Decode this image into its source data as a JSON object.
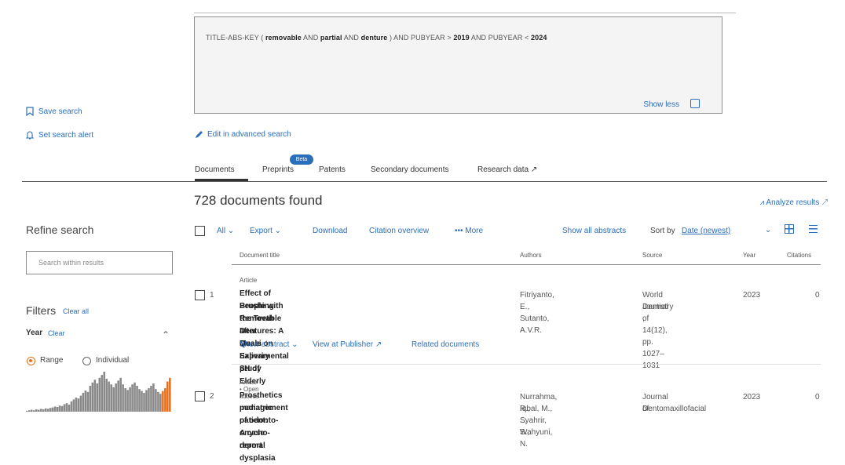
{
  "query": {
    "prefix": "TITLE-ABS-KEY ( ",
    "t1": "removable",
    "op1": " AND ",
    "t2": "partial",
    "op2": " AND ",
    "t3": "denture",
    "mid": " ) AND PUBYEAR > ",
    "y1": "2019",
    "mid2": " AND PUBYEAR < ",
    "y2": "2024",
    "show_less": "Show less"
  },
  "sidebar": {
    "save_search": "Save search",
    "set_alert": "Set search alert",
    "refine_title": "Refine search",
    "search_within_placeholder": "Search within results",
    "filters_title": "Filters",
    "clear_all": "Clear all",
    "year_label": "Year",
    "year_clear": "Clear",
    "range_label": "Range",
    "individual_label": "Individual"
  },
  "edit_advanced": "Edit in advanced search",
  "tabs": {
    "documents": "Documents",
    "preprints": "Preprints",
    "beta": "Beta",
    "patents": "Patents",
    "secondary": "Secondary documents",
    "research_data": "Research data ↗"
  },
  "results": {
    "count_text": "728 documents found",
    "analyze": "Analyze results ↗"
  },
  "toolbar": {
    "all": "All ⌄",
    "export": "Export ⌄",
    "download": "Download",
    "citation_overview": "Citation overview",
    "more": "••• More",
    "show_all_abstracts": "Show all abstracts",
    "sort_by": "Sort by",
    "sort_value": "Date (newest)"
  },
  "columns": {
    "title": "Document title",
    "authors": "Authors",
    "source": "Source",
    "year": "Year",
    "citations": "Citations"
  },
  "rows": [
    {
      "num": "1",
      "type": "Article",
      "title_l1": "Effect of Brushing the Teeth after Meals on Salivary pH of Elderly",
      "title_l2": "People with Removable Dentures: A Quasi Experimental Study",
      "authors": "Fitriyanto, E., Sutanto, A.V.R.",
      "source_l1": "World Journal of",
      "source_l2": "Dentistry",
      "source_l3": ", 14(12), pp. 1027–1031",
      "year": "2023",
      "citations": "0",
      "show_abstract": "Show abstract ⌄",
      "view_publisher": "View at Publisher ↗",
      "related": "Related documents"
    },
    {
      "num": "2",
      "type": "Article • Open access",
      "title_l1": "Prosthetics management of odonto-onycho-dermal dysplasia",
      "title_l2": "pediatric patient: A case report",
      "authors_l1": "Nurrahma, R., Syahrir, S.,",
      "authors_l2": "Iqbal, M., ... Wahyuni, N.",
      "source_l1": "Journal of",
      "source_l2": "Dentomaxillofacial",
      "year": "2023",
      "citations": "0"
    }
  ],
  "histogram": {
    "values": [
      2,
      3,
      4,
      3,
      5,
      4,
      6,
      5,
      7,
      6,
      8,
      9,
      11,
      10,
      13,
      12,
      16,
      18,
      15,
      22,
      26,
      30,
      28,
      34,
      40,
      45,
      42,
      55,
      62,
      68,
      60,
      72,
      78,
      85,
      70,
      64,
      58,
      52,
      60,
      66,
      72,
      58,
      50,
      46,
      52,
      58,
      62,
      55,
      48,
      44,
      40,
      46,
      50,
      55,
      60,
      48,
      42,
      38,
      44,
      50,
      64,
      72
    ],
    "accent": "#e9711c",
    "bar_color": "#8a8a8a"
  }
}
